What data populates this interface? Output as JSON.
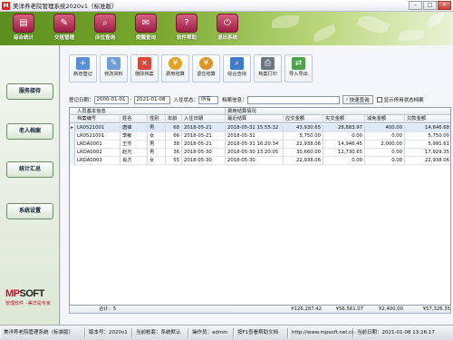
{
  "window": {
    "title": "美洋养老院管理系统2020v1（标准版）",
    "app_icon": "M",
    "controls": {
      "minimize": "–",
      "maximize": "□",
      "close": "×"
    }
  },
  "topnav": [
    {
      "label": "综合统计",
      "icon": "stats-icon",
      "glyph": "▤"
    },
    {
      "label": "交班管理",
      "icon": "handover-icon",
      "glyph": "✎"
    },
    {
      "label": "床位查询",
      "icon": "bed-search-icon",
      "glyph": "⌕"
    },
    {
      "label": "提醒查询",
      "icon": "reminder-icon",
      "glyph": "✉"
    },
    {
      "label": "软件帮助",
      "icon": "help-icon",
      "glyph": "?"
    },
    {
      "label": "退出系统",
      "icon": "exit-icon",
      "glyph": "⏻"
    }
  ],
  "sidebar": {
    "items": [
      {
        "label": "服务接待"
      },
      {
        "label": "老人档案"
      },
      {
        "label": "统计汇总"
      },
      {
        "label": "系统设置"
      }
    ],
    "logo": {
      "brand_mp": "MP",
      "brand_soft": "SOFT",
      "tagline": "管理软件 · 美洋是专家"
    }
  },
  "toolbar": [
    {
      "label": "新增登记",
      "icon": "new-record-icon",
      "glyph": "+",
      "color": "#5a8fd6"
    },
    {
      "label": "修改资料",
      "icon": "edit-icon",
      "glyph": "✎",
      "color": "#6f9ed8"
    },
    {
      "label": "删除档案",
      "icon": "delete-icon",
      "glyph": "×",
      "color": "#d44a3a"
    },
    {
      "label": "费用结算",
      "icon": "fee-settle-icon",
      "glyph": "¥",
      "color": "#e3a126"
    },
    {
      "label": "退住结算",
      "icon": "checkout-settle-icon",
      "glyph": "¥",
      "color": "#d9952a"
    },
    {
      "label": "综合查询",
      "icon": "search-icon",
      "glyph": "⌕",
      "color": "#3d7bc9"
    },
    {
      "label": "档案打印",
      "icon": "print-icon",
      "glyph": "⎙",
      "color": "#6b7685"
    },
    {
      "label": "导入导出",
      "icon": "import-export-icon",
      "glyph": "⇄",
      "color": "#4fa24b"
    }
  ],
  "search": {
    "date_label": "登记日期：",
    "date_from": "2000-01-01",
    "date_sep": "-",
    "date_to": "2021-01-08",
    "status_label": "入住状态：",
    "status_value": "所有",
    "archive_label": "档案信息：",
    "archive_value": "",
    "quick_search_label": "快速查询",
    "show_inactive_label": "显示停用状态档案"
  },
  "table": {
    "group_basic": "人员基本信息",
    "group_fee": "费用结算情况",
    "headers": [
      "档案编号",
      "姓名",
      "性别",
      "年龄",
      "入住日期",
      "最近结算",
      "应交金额",
      "实交金额",
      "减免金额",
      "欠款金额"
    ],
    "rows": [
      [
        "LR0521001",
        "唐锋",
        "男",
        "68",
        "2018-05-21",
        "2018-05-31 15:55:32",
        "43,930.65",
        "28,883.97",
        "400.00",
        "14,646.68"
      ],
      [
        "LR0521001",
        "李敏",
        "女",
        "66",
        "2018-05-21",
        "2018-05-31",
        "5,750.00",
        "0.00",
        "0.00",
        "5,750.00"
      ],
      [
        "LRDA0001",
        "王杰",
        "男",
        "38",
        "2018-05-21",
        "2018-05-31 16:20:34",
        "22,938.06",
        "14,946.45",
        "2,000.00",
        "5,991.61"
      ],
      [
        "LRDA0002",
        "赵光",
        "男",
        "36",
        "2018-05-30",
        "2018-05-30 13:20:05",
        "30,660.00",
        "12,730.65",
        "0.00",
        "17,929.35"
      ],
      [
        "LRDA0003",
        "肖方",
        "女",
        "55",
        "2018-05-30",
        "2018-05-30",
        "22,938.06",
        "0.00",
        "0.00",
        "22,938.06"
      ]
    ],
    "selected_row": 0,
    "summary": {
      "count_label": "合计：",
      "count": "5",
      "due": "¥126,287.42",
      "paid": "¥56,561.07",
      "waived": "¥2,400.00",
      "owed": "¥57,326.35"
    }
  },
  "statusbar": {
    "system": "美洋养老院管理系统（标准版）",
    "version": "版本号：2020v1",
    "account": "当前帐套：系统默认",
    "operator": "操作员：admin",
    "help": "按F1查看帮助文档",
    "site": "http://www.mpsoft.net.cn",
    "date": "当前日期：2021-01-08 13:26:17"
  }
}
